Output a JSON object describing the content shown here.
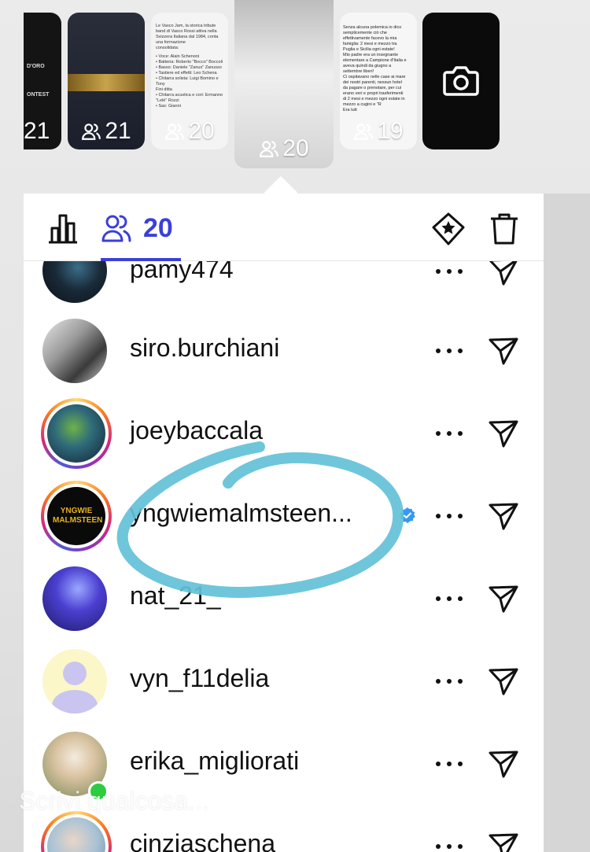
{
  "stories": [
    {
      "count": "21",
      "text_lines": [
        "D'ORO",
        "ONTEST"
      ]
    },
    {
      "count": "21"
    },
    {
      "count": "20",
      "doc_lines": [
        "Le Vasco Jam, la storica tribute",
        "band di Vasco Rossi attiva nella",
        "Svizzera Italiana dal 1984, conta",
        "una formazione",
        "consolidata:",
        "• Voce: Alain Schenoni",
        "• Batteria: Roberto \"Bocco\" Boccoli",
        "• Basso: Daniele \"Zanus\" Zanusso",
        "• Tastiere ed effetti: Leo Schena",
        "• Chitarra solista: Luigi Bomino e Tony",
        "  Fini ditta",
        "• Chitarra acustica e cori: Ermanno",
        "  \"Lelè\" Rozzi",
        "• Sax: Gianni"
      ]
    },
    {
      "count": "20"
    },
    {
      "count": "19",
      "doc_lines": [
        "Senza alcuna polemica io dico",
        "semplicemente ciò che",
        "effettivamente facevo la mia",
        "famiglia: 2 mesi e mezzo tra",
        "Puglia e Sicilia ogni estate!",
        "Mio padre era un insegnante",
        "elementare a Campione d'Italia e",
        "aveva quindi da giugno a",
        "settembre liberi!",
        "Ci ospitavano nelle case ai mare",
        "dei nostri parenti, nessun hotel",
        "da pagare o prenotare, per cui",
        "erano veri e propri trasferimenti",
        "di 2 mesi e mezzo ogni estate in",
        "mezzo a cugini e \"R",
        "Era tutt"
      ]
    },
    {
      "type": "camera"
    }
  ],
  "toolbar": {
    "viewers_count": "20",
    "icons": [
      "bar-chart-icon",
      "viewers-icon",
      "highlight-icon",
      "trash-icon"
    ]
  },
  "viewers": [
    {
      "username": "pamy474",
      "ring": false
    },
    {
      "username": "siro.burchiani",
      "ring": false
    },
    {
      "username": "joeybaccala",
      "ring": true
    },
    {
      "username": "yngwiemalmsteen...",
      "ring": true,
      "verified": true,
      "avatar_text": "YNGWIE MALMSTEEN"
    },
    {
      "username": "nat_21_",
      "ring": false
    },
    {
      "username": "vyn_f11delia",
      "ring": false,
      "placeholder": true
    },
    {
      "username": "erika_migliorati",
      "ring": false,
      "online": true
    },
    {
      "username": "cinziaschena",
      "ring": true
    }
  ],
  "composer": {
    "placeholder": "Scrivi qualcosa..."
  },
  "colors": {
    "accent": "#3b3fd9",
    "verified": "#3897f0",
    "annotation": "#63c1d8"
  }
}
